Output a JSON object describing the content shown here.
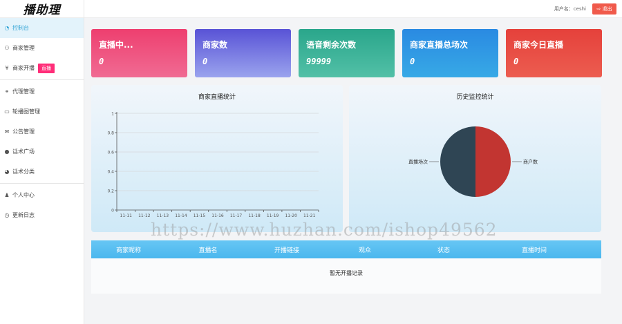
{
  "brand": {
    "logo_text": "播助理"
  },
  "topbar": {
    "user_label": "用户名：ceshi",
    "logout_label": "退出"
  },
  "sidebar": {
    "items": [
      {
        "label": "控制台",
        "icon": "dashboard-icon",
        "glyph": "◔",
        "active": true
      },
      {
        "label": "商家管理",
        "icon": "users-icon",
        "glyph": "⚇"
      },
      {
        "label": "商家开播",
        "icon": "yen-icon",
        "glyph": "¥",
        "badge": "直播"
      },
      {
        "label": "代理管理",
        "icon": "handshake-icon",
        "glyph": "⚭"
      },
      {
        "label": "轮播图管理",
        "icon": "monitor-icon",
        "glyph": "▭"
      },
      {
        "label": "公告管理",
        "icon": "envelope-icon",
        "glyph": "✉"
      },
      {
        "label": "话术广场",
        "icon": "comment-icon",
        "glyph": "●"
      },
      {
        "label": "话术分类",
        "icon": "pie-icon",
        "glyph": "◕"
      },
      {
        "label": "个人中心",
        "icon": "user-icon",
        "glyph": "♟"
      },
      {
        "label": "更新日志",
        "icon": "clock-icon",
        "glyph": "◷"
      }
    ]
  },
  "cards": [
    {
      "title": "直播中...",
      "value": "0"
    },
    {
      "title": "商家数",
      "value": "0"
    },
    {
      "title": "语音剩余次数",
      "value": "99999"
    },
    {
      "title": "商家直播总场次",
      "value": "0"
    },
    {
      "title": "商家今日直播",
      "value": "0"
    }
  ],
  "chart_data": [
    {
      "type": "line",
      "title": "商家直播统计",
      "categories": [
        "11-11",
        "11-12",
        "11-13",
        "11-14",
        "11-15",
        "11-16",
        "11-17",
        "11-18",
        "11-19",
        "11-20",
        "11-21"
      ],
      "yticks": [
        "0",
        "0.2",
        "0.4",
        "0.6",
        "0.8",
        "1"
      ],
      "ylim": [
        0,
        1
      ],
      "grid": true,
      "series": []
    },
    {
      "type": "pie",
      "title": "历史监控统计",
      "slices": [
        {
          "label": "商户数",
          "value": 50,
          "color": "#c23531"
        },
        {
          "label": "直播场次",
          "value": 50,
          "color": "#2f4554"
        }
      ]
    }
  ],
  "table": {
    "columns": [
      "商家昵称",
      "直播名",
      "开播链接",
      "观众",
      "状态",
      "直播时间"
    ],
    "empty_message": "暂无开播记录"
  },
  "watermark": "https://www.huzhan.com/ishop49562"
}
